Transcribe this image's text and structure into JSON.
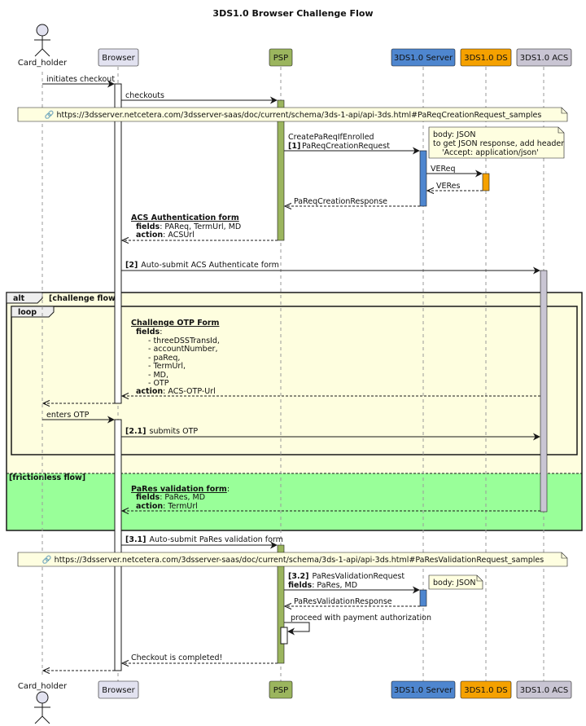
{
  "title": "3DS1.0 Browser Challenge Flow",
  "participants": {
    "card_holder": "Card_holder",
    "browser": "Browser",
    "psp": "PSP",
    "server": "3DS1.0 Server",
    "ds": "3DS1.0 DS",
    "acs": "3DS1.0 ACS"
  },
  "colors": {
    "browser": "#E2E2F0",
    "psp": "#9BB55E",
    "server": "#4E86CF",
    "ds": "#F5A100",
    "acs": "#C9C5D3",
    "note": "#FEFEE0",
    "alt_challenge": "#FEFEDF",
    "alt_frictionless": "#99FF99"
  },
  "messages": {
    "m1": "initiates checkout",
    "m2": "checkouts",
    "m3_a": "CreatePaReqIfEnrolled",
    "m3_num": "[1]",
    "m3_b": "PaReqCreationRequest",
    "m4": "VEReq",
    "m5": "VERes",
    "m6": "PaReqCreationResponse",
    "m7_title": "ACS Authentication form",
    "m7_fields_key": "fields",
    "m7_fields_val": ": PAReq, TermUrl, MD",
    "m7_action_key": "action",
    "m7_action_val": ": ACSUrl",
    "m8_num": "[2]",
    "m8": "Auto-submit ACS Authenticate form",
    "m9_title": "Challenge OTP Form",
    "m9_fields_key": "fields",
    "m9_fields_colon": ":",
    "m9_f1": "- threeDSSTransId,",
    "m9_f2": "- accountNumber,",
    "m9_f3": "- paReq,",
    "m9_f4": "- TermUrl,",
    "m9_f5": "- MD,",
    "m9_f6": "- OTP",
    "m9_action_key": "action",
    "m9_action_val": ": ACS-OTP-Url",
    "m10": "enters OTP",
    "m11_num": "[2.1]",
    "m11": "submits OTP",
    "m12_title": "PaRes validation form",
    "m12_colon": ":",
    "m12_fields_key": "fields",
    "m12_fields_val": ": PaRes, MD",
    "m12_action_key": "action",
    "m12_action_val": ": TermUrl",
    "m13_num": "[3.1]",
    "m13": "Auto-submit PaRes validation form",
    "m14_num": "[3.2]",
    "m14": "PaResValidationRequest",
    "m14_fields_key": "fields",
    "m14_fields_val": ": PaRes, MD",
    "m15": "PaResValidationResponse",
    "m16": "proceed with payment authorization",
    "m17": "Checkout is completed!"
  },
  "notes": {
    "link1": "🔗 https://3dsserver.netcetera.com/3dsserver-saas/doc/current/schema/3ds-1-api/api-3ds.html#PaReqCreationRequest_samples",
    "json1_l1": "body: JSON",
    "json1_l2": "to get JSON response, add header",
    "json1_l3": "'Accept: application/json'",
    "link2": "🔗 https://3dsserver.netcetera.com/3dsserver-saas/doc/current/schema/3ds-1-api/api-3ds.html#PaResValidationRequest_samples",
    "json2": "body: JSON"
  },
  "fragments": {
    "alt_keyword": "alt",
    "alt_guard1": "[challenge flow]",
    "loop_keyword": "loop",
    "alt_guard2": "[frictionless flow]"
  }
}
